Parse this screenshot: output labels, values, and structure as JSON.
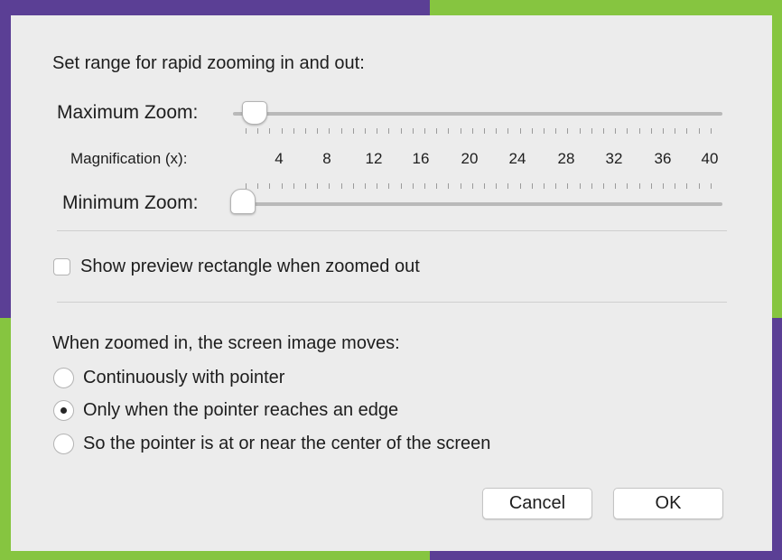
{
  "colors": {
    "bg_purple": "#5b3f95",
    "bg_green": "#86c540",
    "dialog_bg": "#ececec"
  },
  "dialog": {
    "title": "Set range for rapid zooming in and out:",
    "maximum_zoom": {
      "label": "Maximum Zoom:",
      "value": 1
    },
    "magnification": {
      "label": "Magnification (x):",
      "ticks": [
        "4",
        "8",
        "12",
        "16",
        "20",
        "24",
        "28",
        "32",
        "36",
        "40"
      ]
    },
    "minimum_zoom": {
      "label": "Minimum Zoom:",
      "value": 1
    },
    "preview_checkbox": {
      "label": "Show preview rectangle when zoomed out",
      "checked": false
    },
    "movement": {
      "label": "When zoomed in, the screen image moves:",
      "options": [
        {
          "label": "Continuously with pointer",
          "selected": false
        },
        {
          "label": "Only when the pointer reaches an edge",
          "selected": true
        },
        {
          "label": "So the pointer is at or near the center of the screen",
          "selected": false
        }
      ]
    },
    "buttons": {
      "cancel": "Cancel",
      "ok": "OK"
    }
  }
}
